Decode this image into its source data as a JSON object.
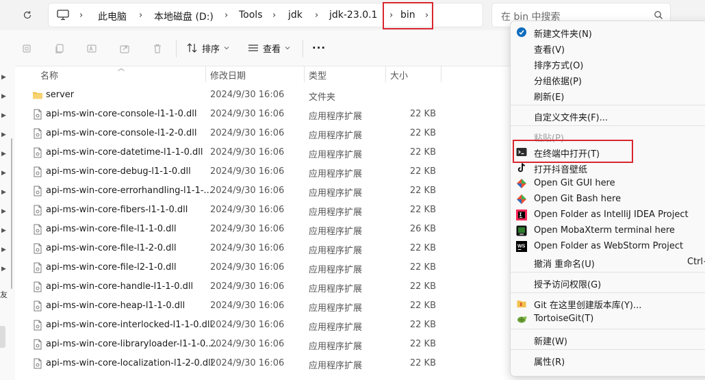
{
  "address_bar": {
    "crumbs": [
      "此电脑",
      "本地磁盘 (D:)",
      "Tools",
      "jdk",
      "jdk-23.0.1",
      "bin"
    ],
    "search_placeholder": "在 bin 中搜索"
  },
  "toolbar": {
    "sort_label": "排序",
    "view_label": "查看",
    "more_label": "···"
  },
  "columns": {
    "name": "名称",
    "date": "修改日期",
    "type": "类型",
    "size": "大小"
  },
  "files": [
    {
      "name": "server",
      "date": "2024/9/30 16:06",
      "type": "文件夹",
      "size": "",
      "kind": "folder"
    },
    {
      "name": "api-ms-win-core-console-l1-1-0.dll",
      "date": "2024/9/30 16:06",
      "type": "应用程序扩展",
      "size": "22 KB",
      "kind": "dll"
    },
    {
      "name": "api-ms-win-core-console-l1-2-0.dll",
      "date": "2024/9/30 16:06",
      "type": "应用程序扩展",
      "size": "22 KB",
      "kind": "dll"
    },
    {
      "name": "api-ms-win-core-datetime-l1-1-0.dll",
      "date": "2024/9/30 16:06",
      "type": "应用程序扩展",
      "size": "22 KB",
      "kind": "dll"
    },
    {
      "name": "api-ms-win-core-debug-l1-1-0.dll",
      "date": "2024/9/30 16:06",
      "type": "应用程序扩展",
      "size": "22 KB",
      "kind": "dll"
    },
    {
      "name": "api-ms-win-core-errorhandling-l1-1-...",
      "date": "2024/9/30 16:06",
      "type": "应用程序扩展",
      "size": "22 KB",
      "kind": "dll"
    },
    {
      "name": "api-ms-win-core-fibers-l1-1-0.dll",
      "date": "2024/9/30 16:06",
      "type": "应用程序扩展",
      "size": "22 KB",
      "kind": "dll"
    },
    {
      "name": "api-ms-win-core-file-l1-1-0.dll",
      "date": "2024/9/30 16:06",
      "type": "应用程序扩展",
      "size": "26 KB",
      "kind": "dll"
    },
    {
      "name": "api-ms-win-core-file-l1-2-0.dll",
      "date": "2024/9/30 16:06",
      "type": "应用程序扩展",
      "size": "22 KB",
      "kind": "dll"
    },
    {
      "name": "api-ms-win-core-file-l2-1-0.dll",
      "date": "2024/9/30 16:06",
      "type": "应用程序扩展",
      "size": "22 KB",
      "kind": "dll"
    },
    {
      "name": "api-ms-win-core-handle-l1-1-0.dll",
      "date": "2024/9/30 16:06",
      "type": "应用程序扩展",
      "size": "22 KB",
      "kind": "dll"
    },
    {
      "name": "api-ms-win-core-heap-l1-1-0.dll",
      "date": "2024/9/30 16:06",
      "type": "应用程序扩展",
      "size": "22 KB",
      "kind": "dll"
    },
    {
      "name": "api-ms-win-core-interlocked-l1-1-0.dll",
      "date": "2024/9/30 16:06",
      "type": "应用程序扩展",
      "size": "22 KB",
      "kind": "dll"
    },
    {
      "name": "api-ms-win-core-libraryloader-l1-1-0....",
      "date": "2024/9/30 16:06",
      "type": "应用程序扩展",
      "size": "22 KB",
      "kind": "dll"
    },
    {
      "name": "api-ms-win-core-localization-l1-2-0.dll",
      "date": "2024/9/30 16:06",
      "type": "应用程序扩展",
      "size": "22 KB",
      "kind": "dll"
    }
  ],
  "context_menu": {
    "items": [
      {
        "label": "新建文件夹(N)",
        "icon": "new-folder-icon"
      },
      {
        "label": "查看(V)"
      },
      {
        "label": "排序方式(O)"
      },
      {
        "label": "分组依据(P)"
      },
      {
        "label": "刷新(E)"
      },
      {
        "label": "自定义文件夹(F)..."
      },
      {
        "label": "粘贴(P)",
        "disabled": true
      },
      {
        "label": "在终端中打开(T)",
        "icon": "terminal-icon"
      },
      {
        "label": "打开抖音壁纸",
        "icon": "tiktok-icon"
      },
      {
        "label": "Open Git GUI here",
        "icon": "git-gui-icon"
      },
      {
        "label": "Open Git Bash here",
        "icon": "git-bash-icon"
      },
      {
        "label": "Open Folder as IntelliJ IDEA Project",
        "icon": "intellij-icon"
      },
      {
        "label": "Open MobaXterm terminal here",
        "icon": "mobaxterm-icon"
      },
      {
        "label": "Open Folder as WebStorm Project",
        "icon": "webstorm-icon"
      },
      {
        "label": "撤消 重命名(U)",
        "shortcut": "Ctrl+"
      },
      {
        "label": "授予访问权限(G)"
      },
      {
        "label": "Git 在这里创建版本库(Y)...",
        "icon": "git-create-icon"
      },
      {
        "label": "TortoiseGit(T)",
        "icon": "tortoisegit-icon"
      },
      {
        "label": "新建(W)"
      },
      {
        "label": "属性(R)"
      }
    ]
  },
  "nav": {
    "cut_text": "友"
  },
  "colors": {
    "highlight_red": "#d9262e",
    "accent_blue": "#0f6cbd",
    "folder_yellow": "#f2c14e"
  }
}
